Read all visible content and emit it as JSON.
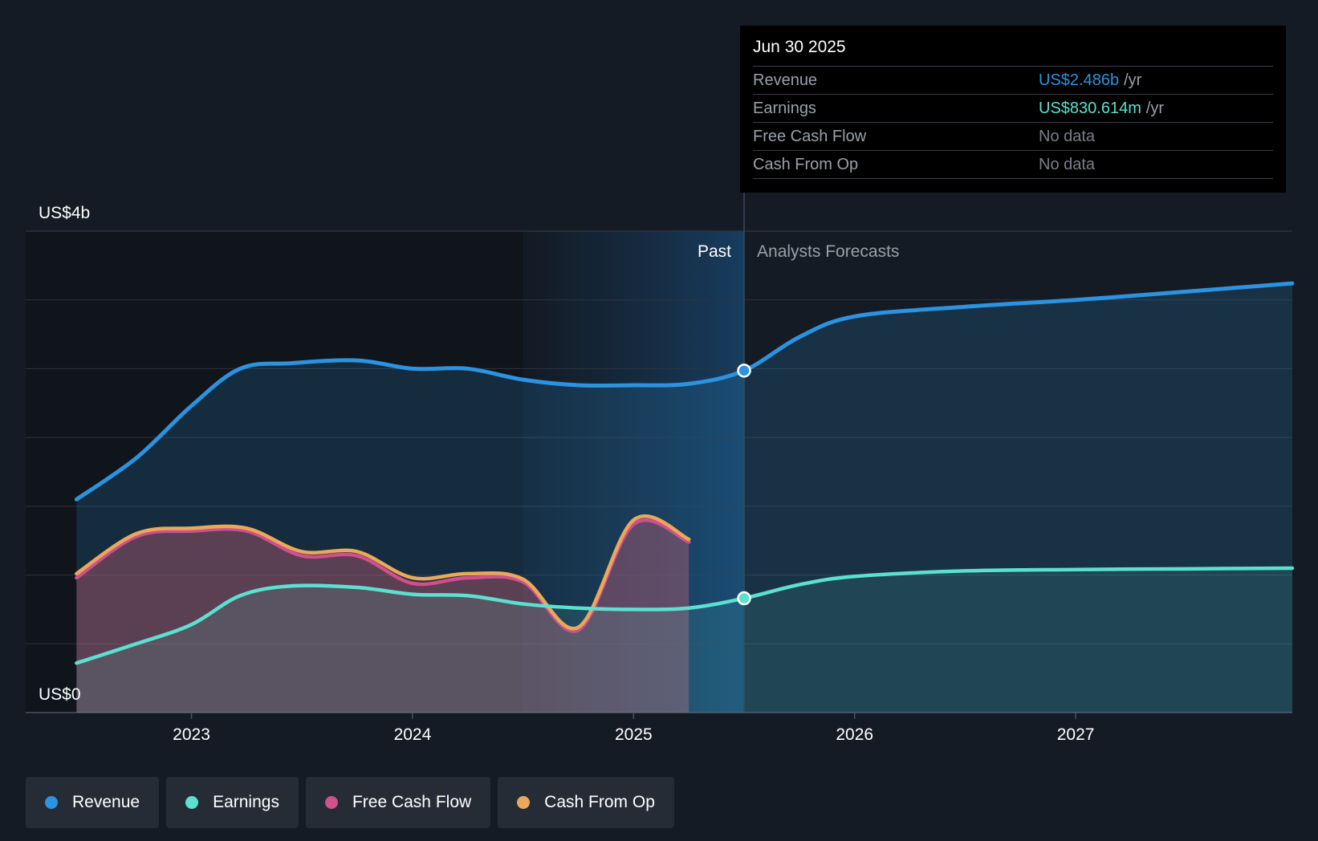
{
  "chart_data": {
    "type": "area",
    "y_axis": {
      "ticks": [
        "US$4b",
        "US$0"
      ],
      "ylim": [
        0,
        3.5
      ]
    },
    "x_axis": {
      "ticks": [
        "2023",
        "2024",
        "2025",
        "2026",
        "2027"
      ],
      "xlim": [
        2022.25,
        2027.98
      ]
    },
    "regions": {
      "past_label": "Past",
      "forecast_label": "Analysts Forecasts",
      "divider_x": 2025.5
    },
    "series": [
      {
        "name": "Revenue",
        "color": "#2b93e0",
        "x": [
          2022.48,
          2022.75,
          2023.0,
          2023.22,
          2023.45,
          2023.75,
          2024.0,
          2024.25,
          2024.5,
          2024.75,
          2025.0,
          2025.25,
          2025.5,
          2025.75,
          2026.0,
          2026.5,
          2027.0,
          2027.5,
          2027.98
        ],
        "y": [
          1.55,
          1.85,
          2.23,
          2.5,
          2.54,
          2.56,
          2.5,
          2.5,
          2.42,
          2.38,
          2.38,
          2.39,
          2.486,
          2.73,
          2.88,
          2.95,
          3.0,
          3.06,
          3.12
        ]
      },
      {
        "name": "Earnings",
        "color": "#5ce0cf",
        "x": [
          2022.48,
          2022.75,
          2023.0,
          2023.22,
          2023.45,
          2023.75,
          2024.0,
          2024.25,
          2024.5,
          2024.75,
          2025.0,
          2025.25,
          2025.5,
          2025.75,
          2026.0,
          2026.5,
          2027.0,
          2027.5,
          2027.98
        ],
        "y": [
          0.36,
          0.5,
          0.64,
          0.85,
          0.92,
          0.91,
          0.86,
          0.85,
          0.79,
          0.76,
          0.75,
          0.76,
          0.831,
          0.93,
          0.99,
          1.03,
          1.04,
          1.045,
          1.05
        ]
      },
      {
        "name": "Free Cash Flow",
        "color": "#d04f8c",
        "x": [
          2022.48,
          2022.75,
          2023.0,
          2023.25,
          2023.5,
          2023.75,
          2024.0,
          2024.25,
          2024.5,
          2024.75,
          2025.0,
          2025.25
        ],
        "y": [
          0.98,
          1.28,
          1.32,
          1.32,
          1.14,
          1.14,
          0.94,
          0.98,
          0.95,
          0.6,
          1.37,
          1.24
        ]
      },
      {
        "name": "Cash From Op",
        "color": "#e8a95a",
        "x": [
          2022.48,
          2022.75,
          2023.0,
          2023.25,
          2023.5,
          2023.75,
          2024.0,
          2024.25,
          2024.5,
          2024.75,
          2025.0,
          2025.25
        ],
        "y": [
          1.01,
          1.3,
          1.34,
          1.34,
          1.17,
          1.17,
          0.98,
          1.01,
          0.97,
          0.62,
          1.4,
          1.26
        ]
      }
    ],
    "tooltip": {
      "date": "Jun 30 2025",
      "rows": [
        {
          "label": "Revenue",
          "value": "US$2.486b",
          "unit": "/yr",
          "color": "#2b93e0"
        },
        {
          "label": "Earnings",
          "value": "US$830.614m",
          "unit": "/yr",
          "color": "#5ce0cf"
        },
        {
          "label": "Free Cash Flow",
          "value": "No data",
          "unit": "",
          "color": "#7a7f87"
        },
        {
          "label": "Cash From Op",
          "value": "No data",
          "unit": "",
          "color": "#7a7f87"
        }
      ]
    },
    "legend": [
      {
        "label": "Revenue",
        "color": "#2b93e0"
      },
      {
        "label": "Earnings",
        "color": "#5ce0cf"
      },
      {
        "label": "Free Cash Flow",
        "color": "#d04f8c"
      },
      {
        "label": "Cash From Op",
        "color": "#e8a95a"
      }
    ]
  }
}
